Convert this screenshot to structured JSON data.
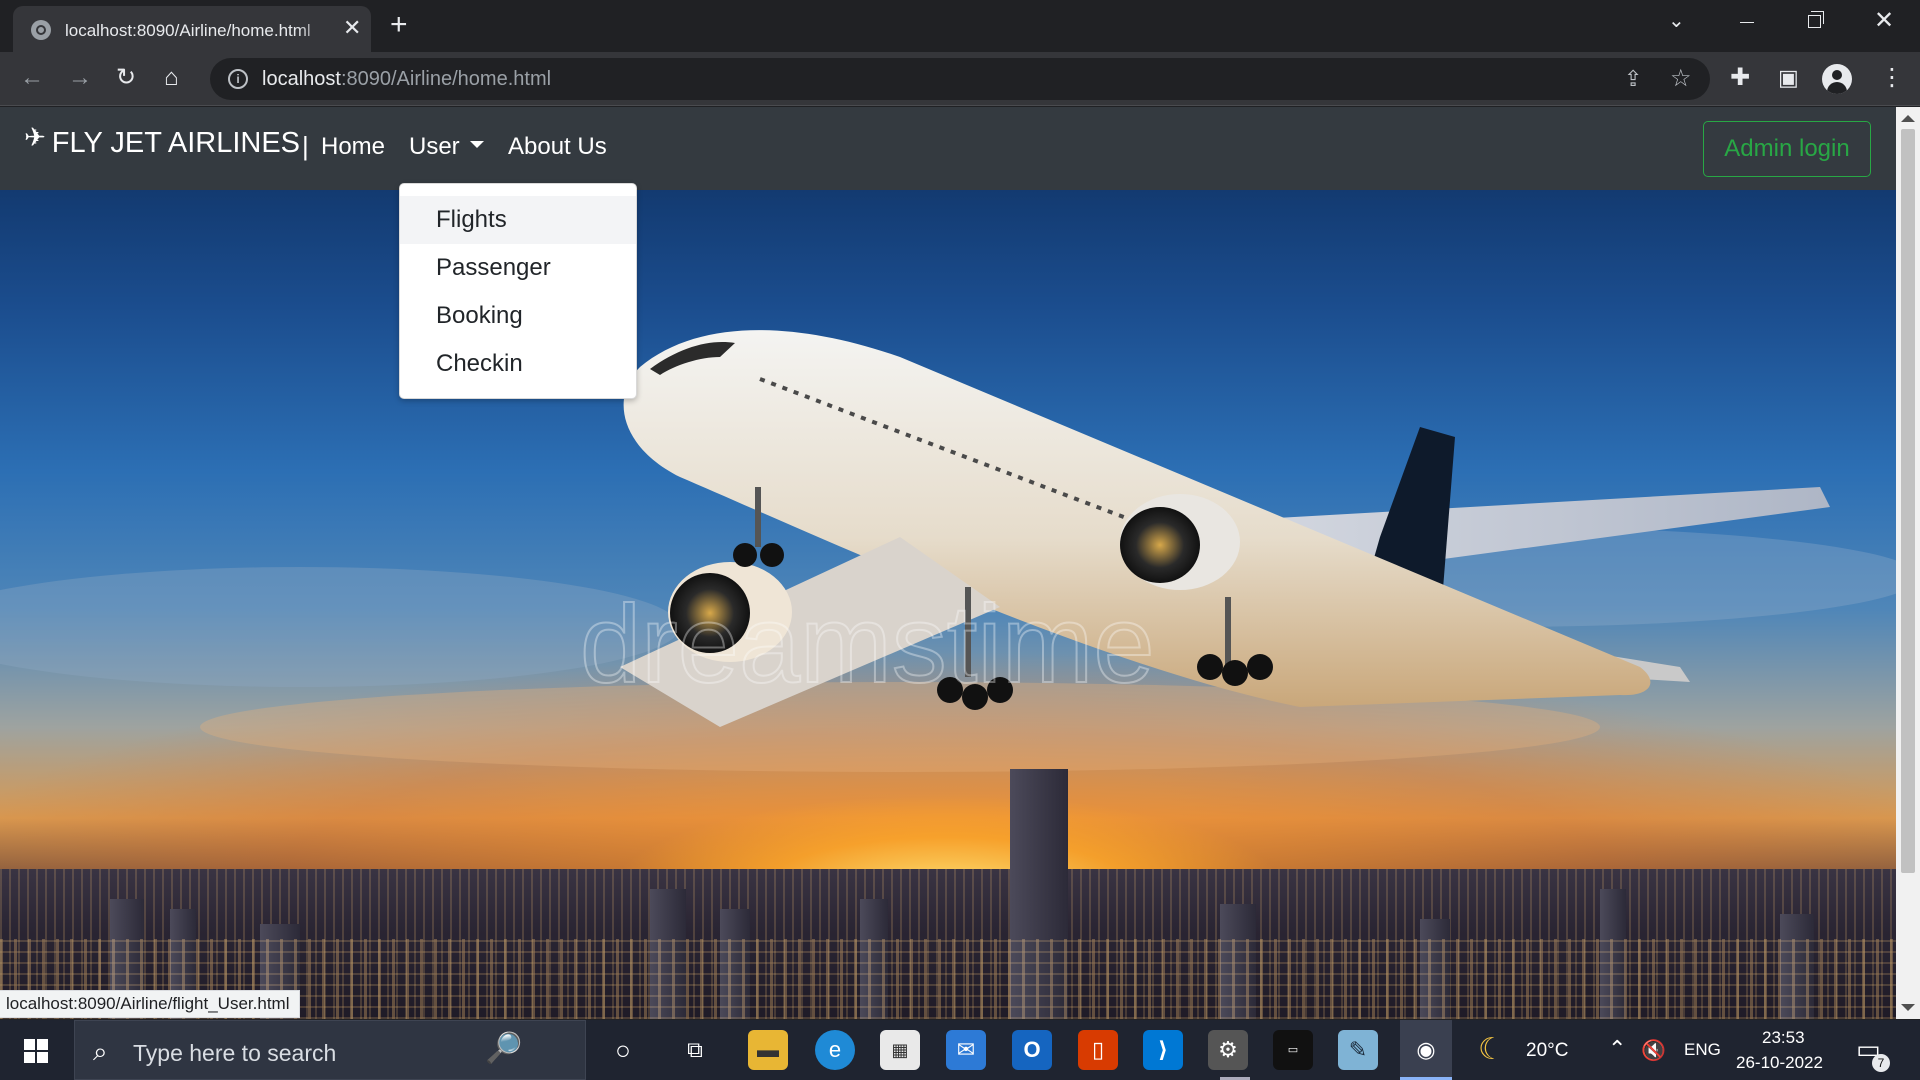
{
  "browser": {
    "tab_title": "localhost:8090/Airline/home.html",
    "url_host": "localhost",
    "url_rest": ":8090/Airline/home.html",
    "status_url": "localhost:8090/Airline/flight_User.html"
  },
  "navbar": {
    "brand": "FLY JET AIRLINES",
    "separator": "|",
    "home": "Home",
    "user": "User",
    "about": "About Us",
    "admin_login": "Admin login"
  },
  "dropdown": {
    "items": [
      "Flights",
      "Passenger",
      "Booking",
      "Checkin"
    ],
    "hovered": "Flights"
  },
  "hero": {
    "watermark": "dreamstime"
  },
  "taskbar": {
    "search_placeholder": "Type here to search",
    "weather": "20°C",
    "language": "ENG",
    "time": "23:53",
    "date": "26-10-2022",
    "notifications": "7"
  },
  "colors": {
    "navbar_bg": "#343a40",
    "admin_btn": "#28a745",
    "browser_dark": "#202124",
    "toolbar": "#35363a"
  }
}
